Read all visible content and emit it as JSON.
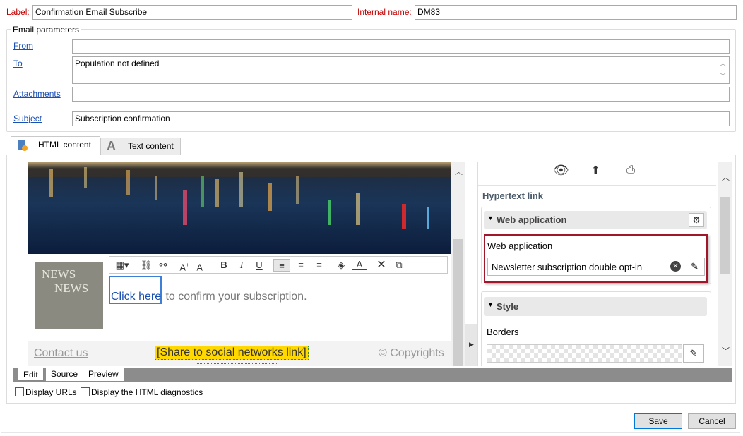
{
  "header": {
    "label_caption": "Label:",
    "label_value": "Confirmation Email Subscribe",
    "internal_name_caption": "Internal name:",
    "internal_name_value": "DM83"
  },
  "email_params": {
    "legend": "Email parameters",
    "from_link": "From",
    "from_value": "",
    "to_link": "To",
    "to_value": "Population not defined",
    "attachments_link": "Attachments",
    "attachments_value": "",
    "subject_link": "Subject",
    "subject_value": "Subscription confirmation"
  },
  "tabs": [
    {
      "label": "HTML content",
      "icon": "html-content-icon",
      "active": true
    },
    {
      "label": "Text content",
      "icon": "text-content-icon",
      "active": false
    }
  ],
  "editor": {
    "news_line1": "NEWS",
    "news_line2": "NEWS",
    "click_here": "Click here",
    "confirm_text": " to confirm your subscription.",
    "contact_us": "Contact us",
    "share_link": "[Share to social networks link]",
    "copyrights": "© Copyrights",
    "toolbar_icons": [
      "insert-block-icon",
      "link-icon",
      "unlink-icon",
      "font-increase-icon",
      "font-decrease-icon",
      "bold-icon",
      "italic-icon",
      "underline-icon",
      "align-left-icon",
      "align-center-icon",
      "align-right-icon",
      "fill-color-icon",
      "text-color-icon",
      "delete-icon",
      "move-icon"
    ],
    "toolbar_glyphs": {
      "bold": "B",
      "italic": "I",
      "underline": "U",
      "font_up": "A",
      "font_down": "A",
      "text_color": "A"
    }
  },
  "props_panel": {
    "title": "Hypertext link",
    "web_app_section": "Web application",
    "web_app_field_label": "Web application",
    "web_app_value": "Newsletter subscription double opt-in",
    "style_section": "Style",
    "borders_label": "Borders",
    "top_icons": [
      "preview-eye-icon",
      "upload-page-icon",
      "save-page-icon"
    ]
  },
  "bottom_tabs": [
    "Edit",
    "Source",
    "Preview"
  ],
  "options": {
    "display_urls": "Display URLs",
    "display_diagnostics": "Display the HTML diagnostics"
  },
  "buttons": {
    "save": "Save",
    "cancel": "Cancel"
  },
  "colors": {
    "label_red": "#c00000",
    "link_blue": "#1a4fb3",
    "highlight_yellow": "#ffd800",
    "selection_red": "#a0162b"
  }
}
